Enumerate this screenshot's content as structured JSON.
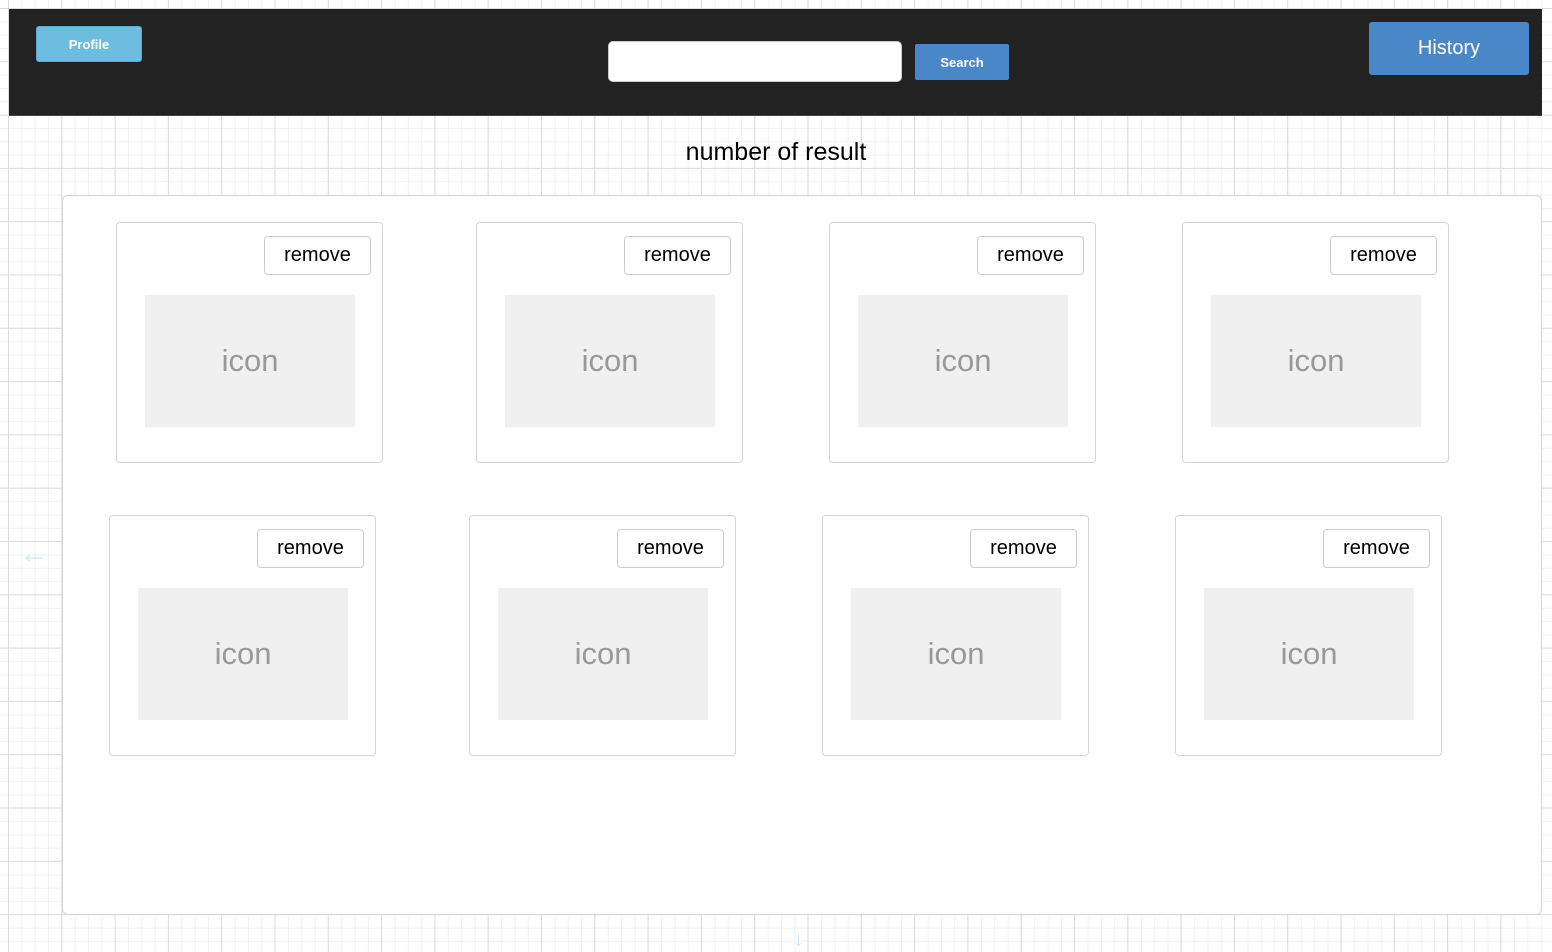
{
  "header": {
    "profile_label": "Profile",
    "search_value": "",
    "search_placeholder": "",
    "search_label": "Search",
    "history_label": "History"
  },
  "results": {
    "count_label": "number of result"
  },
  "cards": [
    {
      "remove_label": "remove",
      "icon_label": "icon"
    },
    {
      "remove_label": "remove",
      "icon_label": "icon"
    },
    {
      "remove_label": "remove",
      "icon_label": "icon"
    },
    {
      "remove_label": "remove",
      "icon_label": "icon"
    },
    {
      "remove_label": "remove",
      "icon_label": "icon"
    },
    {
      "remove_label": "remove",
      "icon_label": "icon"
    },
    {
      "remove_label": "remove",
      "icon_label": "icon"
    },
    {
      "remove_label": "remove",
      "icon_label": "icon"
    }
  ]
}
